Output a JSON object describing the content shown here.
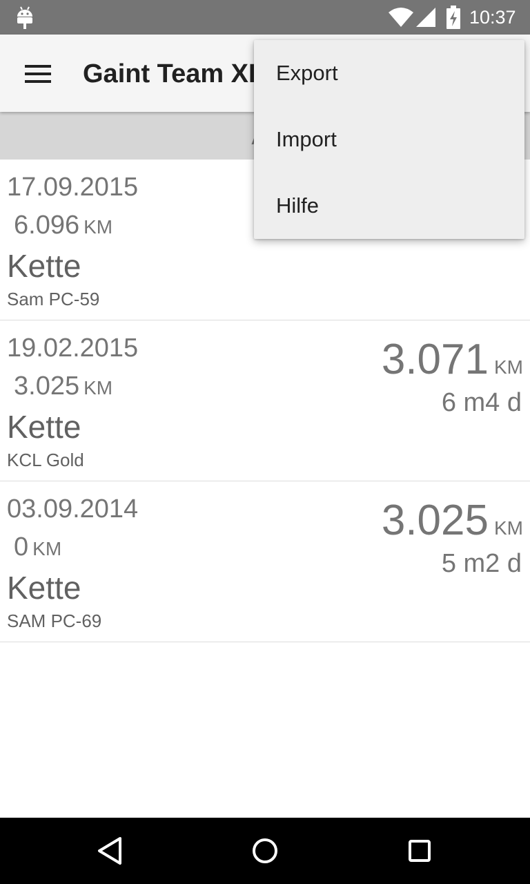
{
  "status_bar": {
    "time": "10:37",
    "icons": [
      "android-icon",
      "wifi-icon",
      "signal-icon",
      "battery-charging-icon"
    ]
  },
  "app_bar": {
    "title": "Gaint Team XL",
    "menu_icon": "hamburger-menu-icon"
  },
  "sub_header": {
    "text": "An"
  },
  "overflow_menu": {
    "items": [
      {
        "label": "Export"
      },
      {
        "label": "Import"
      },
      {
        "label": "Hilfe"
      }
    ]
  },
  "list": {
    "items": [
      {
        "date": "17.09.2015",
        "start_km": "6.096",
        "start_unit": "KM",
        "part": "Kette",
        "model": "Sam PC-59",
        "distance": "",
        "distance_unit": "",
        "duration": ""
      },
      {
        "date": "19.02.2015",
        "start_km": "3.025",
        "start_unit": "KM",
        "part": "Kette",
        "model": "KCL Gold",
        "distance": "3.071",
        "distance_unit": "KM",
        "duration": "6 m4 d"
      },
      {
        "date": "03.09.2014",
        "start_km": "0",
        "start_unit": "KM",
        "part": "Kette",
        "model": "SAM PC-69",
        "distance": "3.025",
        "distance_unit": "KM",
        "duration": "5 m2 d"
      }
    ]
  },
  "nav_bar": {
    "icons": [
      "back-icon",
      "home-icon",
      "recents-icon"
    ]
  },
  "colors": {
    "status_bar": "#757575",
    "app_bar": "#f5f5f5",
    "sub_header": "#d6d6d6",
    "menu_background": "#eeeeee",
    "text_primary": "#212121",
    "text_secondary": "#757575",
    "nav_bar": "#000000"
  }
}
